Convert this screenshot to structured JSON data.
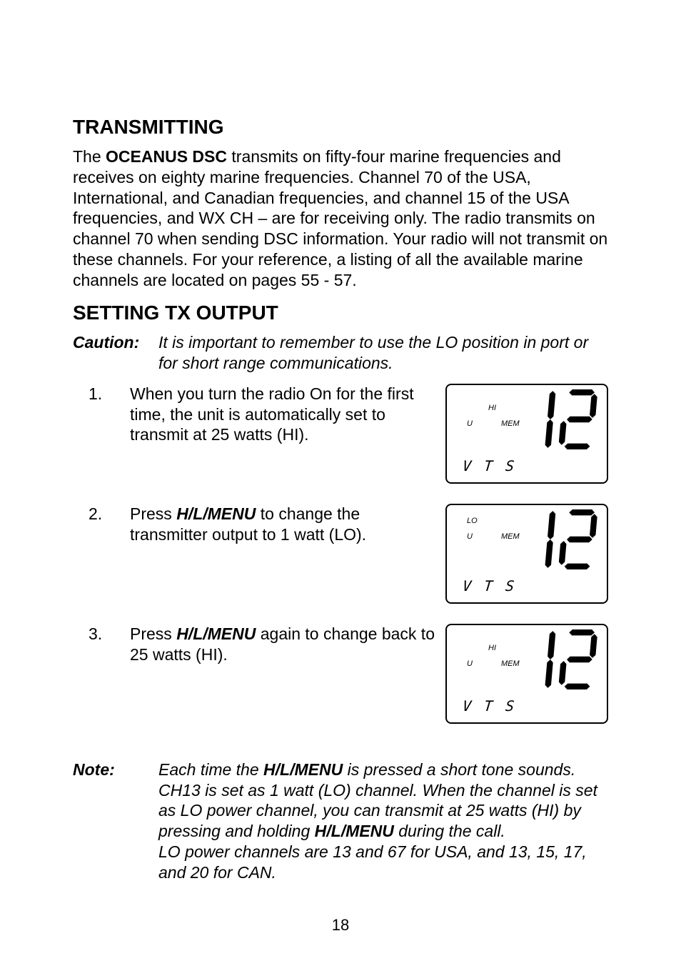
{
  "headings": {
    "transmitting": "TRANSMITTING",
    "setting": "SETTING TX OUTPUT"
  },
  "para1": {
    "pre": "The ",
    "bold": "OCEANUS DSC",
    "post": " transmits on fifty-four marine frequencies and receives on eighty marine frequencies. Channel 70 of the USA, International, and Canadian frequencies, and channel 15 of the USA frequencies, and WX CH – are for receiving only.  The radio transmits on channel 70 when sending DSC information.  Your radio will not transmit on these channels.  For your reference, a listing of all the available marine channels are located on pages 55 - 57."
  },
  "caution": {
    "label": "Caution:",
    "text": "It is important to remember to use the LO position in port or for short range communications."
  },
  "steps": {
    "s1": {
      "num": "1.",
      "text": "When you turn the radio On for the first time, the unit is automatically set to transmit at 25 watts (HI)."
    },
    "s2": {
      "num": "2.",
      "pre": "Press ",
      "bold": "H/L/MENU",
      "post": " to change the transmitter output to 1 watt (LO)."
    },
    "s3": {
      "num": "3.",
      "pre": "Press ",
      "bold": "H/L/MENU",
      "post": " again to change back to 25 watts (HI)."
    }
  },
  "lcd": {
    "hi": "HI",
    "lo": "LO",
    "u": "U",
    "mem": "MEM",
    "vts": "V T S",
    "big": "12"
  },
  "note": {
    "label": "Note:",
    "p1a": "Each time the ",
    "p1b": "H/L/MENU",
    "p1c": " is pressed a short tone sounds. CH13 is set as 1 watt (LO) channel.  When the channel is set as LO power channel, you can transmit at 25 watts (HI) by pressing and holding ",
    "p1d": "H/L/MENU",
    "p1e": " during the call.",
    "p2": "LO power channels are 13 and 67 for USA, and 13, 15, 17, and 20 for CAN."
  },
  "page": "18"
}
